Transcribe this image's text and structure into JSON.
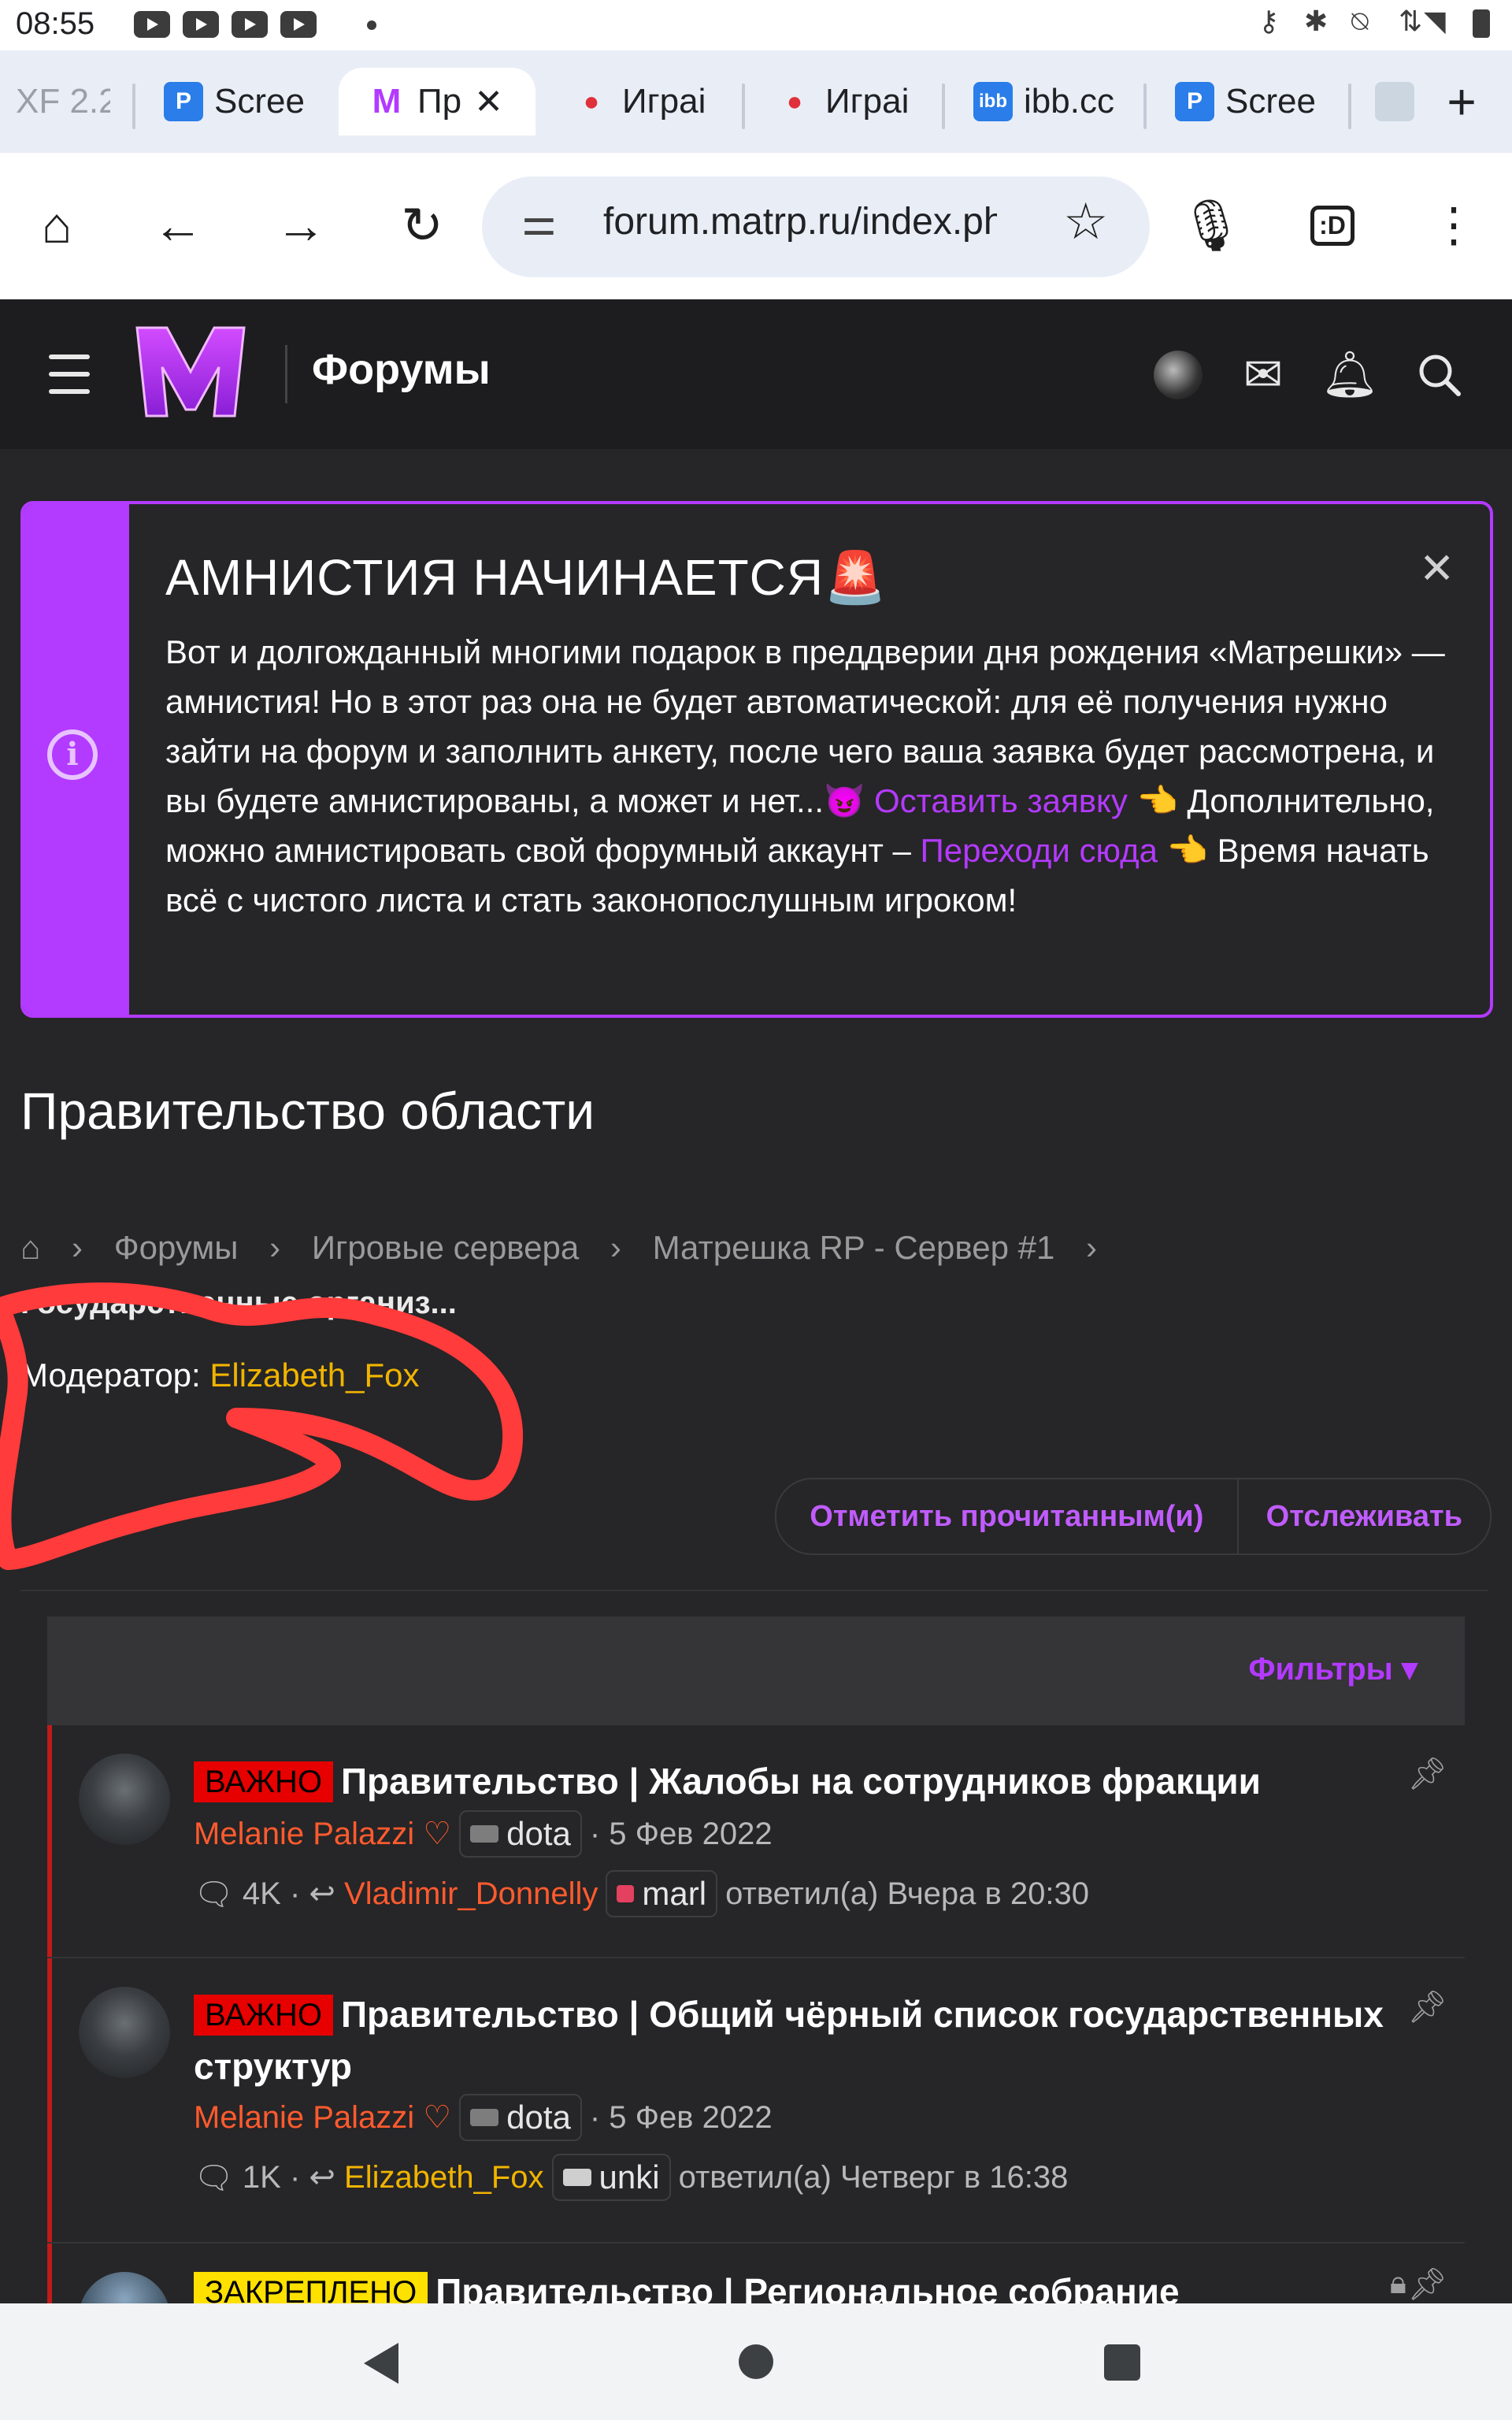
{
  "status_bar": {
    "time": "08:55"
  },
  "tabs": [
    {
      "label": "XF 2.2",
      "favicon": "xf-favicon"
    },
    {
      "label": "Scree",
      "favicon": "screenshot-favicon"
    },
    {
      "label": "Пр",
      "favicon": "matrp-favicon",
      "active": true
    },
    {
      "label": "Играi",
      "favicon": "game-favicon"
    },
    {
      "label": "Играi",
      "favicon": "game-favicon"
    },
    {
      "label": "ibb.cc",
      "favicon": "ibb-favicon"
    },
    {
      "label": "Scree",
      "favicon": "screenshot-favicon"
    }
  ],
  "toolbar": {
    "url": "forum.matrp.ru/index.php",
    "tab_switcher_label": ":D"
  },
  "site_header": {
    "title": "Форумы"
  },
  "notice": {
    "title": "АМНИСТИЯ НАЧИНАЕТСЯ🚨",
    "text1": "Вот и долгожданный многими подарок в преддверии дня рождения «Матрешки» — амнистия! Но в этот раз она не будет автоматической: для её получения нужно зайти на форум и заполнить анкету, после чего ваша заявка будет рассмотрена, и вы будете амнистированы, а может и нет...😈",
    "link1": "Оставить заявку",
    "text2": "👈 Дополнительно, можно амнистировать свой форумный аккаунт –",
    "link2": "Переходи сюда",
    "text3": "👈 Время начать всё с чистого листа и стать законопослушным игроком!"
  },
  "page": {
    "title": "Правительство области",
    "breadcrumbs": [
      "Форумы",
      "Игровые сервера",
      "Матрешка RP - Сервер #1"
    ],
    "breadcrumb_last": "Государственные организ...",
    "moderator_label": "Модератор:",
    "moderator_name": "Elizabeth_Fox",
    "mark_read": "Отметить прочитанным(и)",
    "watch": "Отслеживать",
    "filters": "Фильтры"
  },
  "threads": [
    {
      "label": "ВАЖНО",
      "title": "Правительство | Жалобы на сотрудников фракции",
      "author": "Melanie Palazzi ♡",
      "author_chip": "dota",
      "date": "· 5 Фев 2022",
      "replies": "4K",
      "last_poster": "Vladimir_Donnelly",
      "last_chip": "marl",
      "last_time": "ответил(а) Вчера в 20:30"
    },
    {
      "label": "ВАЖНО",
      "title": "Правительство | Общий чёрный список государственных структур",
      "author": "Melanie Palazzi ♡",
      "author_chip": "dota",
      "date": "· 5 Фев 2022",
      "replies": "1K",
      "last_poster": "Elizabeth_Fox",
      "last_chip": "unki",
      "last_time": "ответил(а) Четверг в 16:38"
    },
    {
      "label": "ЗАКРЕПЛЕНО",
      "title": "Правительство | Региональное собрание"
    }
  ],
  "colors": {
    "accent": "#b33aff",
    "important": "#e60000",
    "pinned": "#ffe100",
    "annotation": "#ff3b3b"
  }
}
